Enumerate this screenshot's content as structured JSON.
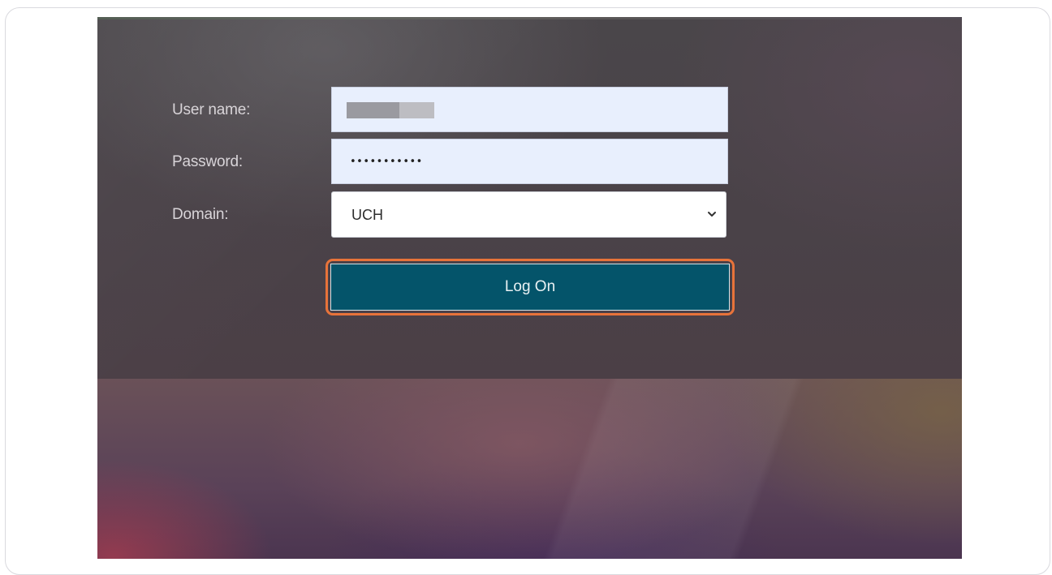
{
  "form": {
    "username_label": "User name:",
    "password_label": "Password:",
    "domain_label": "Domain:",
    "password_value": "•••••••••••",
    "domain_selected": "UCH",
    "submit_label": "Log On"
  },
  "colors": {
    "button_bg": "#04546a",
    "focus_ring": "#e8733a",
    "input_bg": "#e8effd"
  },
  "icons": {
    "domain_dropdown": "chevron-down-icon"
  }
}
